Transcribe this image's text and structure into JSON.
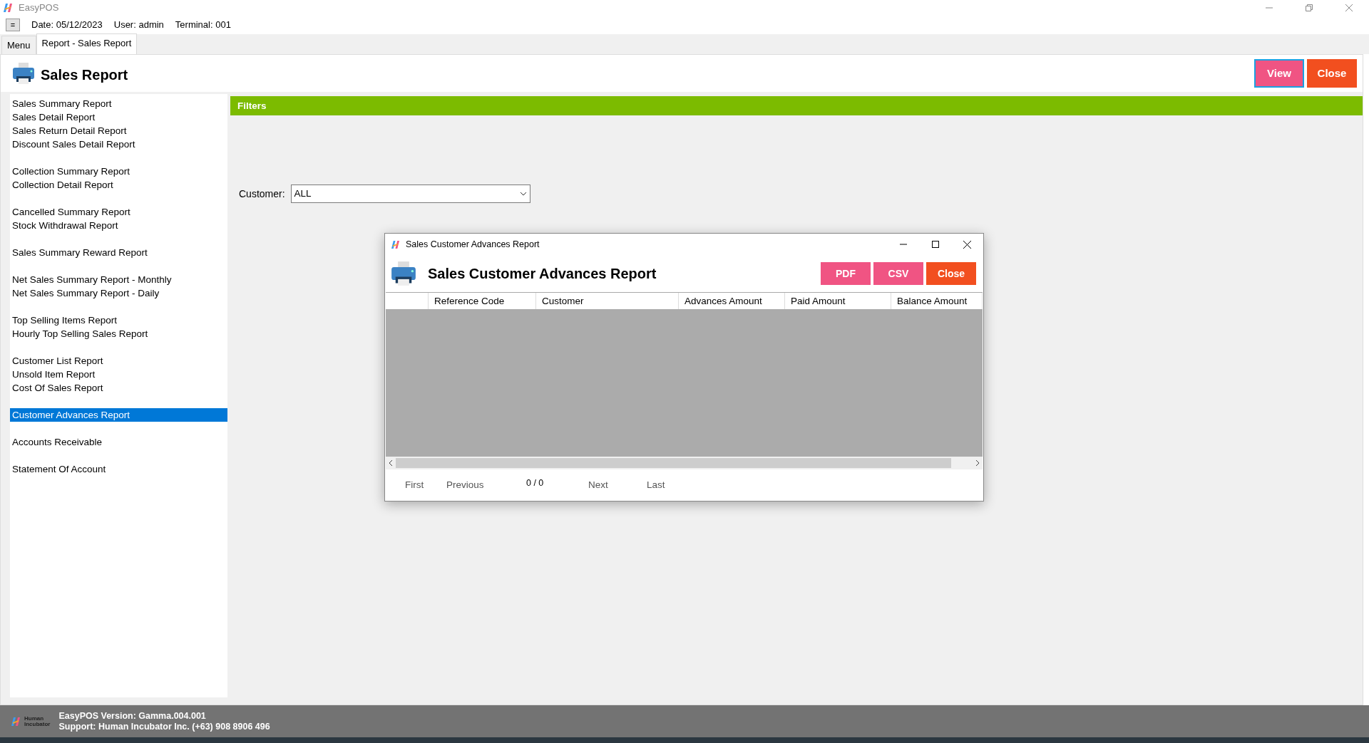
{
  "app": {
    "title": "EasyPOS"
  },
  "toolbar": {
    "menu_button": "=",
    "date": "Date: 05/12/2023",
    "user": "User: admin",
    "terminal": "Terminal: 001"
  },
  "tabs": [
    {
      "label": "Menu",
      "selected": false
    },
    {
      "label": "Report - Sales Report",
      "selected": true
    }
  ],
  "page": {
    "title": "Sales Report",
    "buttons": [
      {
        "label": "View",
        "kind": "view",
        "focused": true
      },
      {
        "label": "Close",
        "kind": "close",
        "focused": false
      }
    ]
  },
  "sidebar": {
    "groups": [
      {
        "items": [
          {
            "label": "Sales Summary Report",
            "selected": false
          },
          {
            "label": "Sales Detail Report",
            "selected": false
          },
          {
            "label": "Sales Return Detail Report",
            "selected": false
          },
          {
            "label": "Discount Sales Detail Report",
            "selected": false
          }
        ]
      },
      {
        "items": [
          {
            "label": "Collection Summary Report",
            "selected": false
          },
          {
            "label": "Collection Detail Report",
            "selected": false
          }
        ]
      },
      {
        "items": [
          {
            "label": "Cancelled Summary Report",
            "selected": false
          },
          {
            "label": "Stock Withdrawal Report",
            "selected": false
          }
        ]
      },
      {
        "items": [
          {
            "label": "Sales Summary Reward Report",
            "selected": false
          }
        ]
      },
      {
        "items": [
          {
            "label": "Net Sales Summary Report - Monthly",
            "selected": false
          },
          {
            "label": "Net Sales Summary Report - Daily",
            "selected": false
          }
        ]
      },
      {
        "items": [
          {
            "label": "Top Selling Items Report",
            "selected": false
          },
          {
            "label": "Hourly Top Selling Sales Report",
            "selected": false
          }
        ]
      },
      {
        "items": [
          {
            "label": "Customer List Report",
            "selected": false
          },
          {
            "label": "Unsold Item Report",
            "selected": false
          },
          {
            "label": "Cost Of Sales Report",
            "selected": false
          }
        ]
      },
      {
        "items": [
          {
            "label": "Customer Advances Report",
            "selected": true
          }
        ]
      },
      {
        "items": [
          {
            "label": "Accounts Receivable",
            "selected": false
          }
        ]
      },
      {
        "items": [
          {
            "label": "Statement Of Account",
            "selected": false
          }
        ]
      }
    ]
  },
  "filters": {
    "title": "Filters",
    "fields": [
      {
        "label": "Customer:",
        "value": "ALL"
      }
    ]
  },
  "dialog": {
    "title": "Sales Customer Advances Report",
    "heading": "Sales Customer Advances Report",
    "buttons": [
      {
        "label": "PDF",
        "kind": "export"
      },
      {
        "label": "CSV",
        "kind": "export"
      },
      {
        "label": "Close",
        "kind": "close"
      }
    ],
    "table": {
      "columns": [
        "Reference Code",
        "Customer",
        "Advances Amount",
        "Paid Amount",
        "Balance Amount"
      ]
    },
    "pager": {
      "first": "First",
      "previous": "Previous",
      "page": "0 / 0",
      "next": "Next",
      "last": "Last"
    }
  },
  "footer": {
    "logo_text": [
      "Human",
      "Incubator"
    ],
    "version": "EasyPOS Version: Gamma.004.001",
    "support": "Support: Human Incubator Inc. (+63) 908 8906 496"
  }
}
